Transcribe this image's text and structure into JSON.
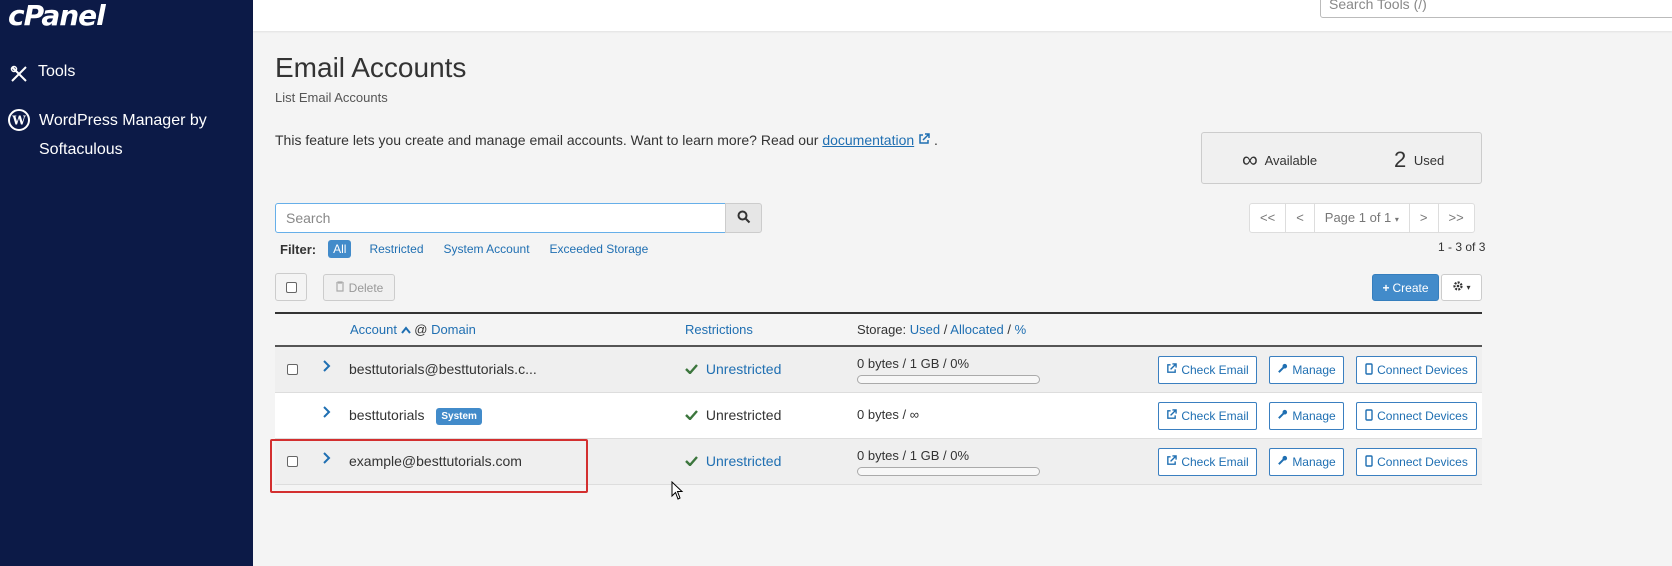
{
  "sidebar": {
    "logo": "cPanel",
    "items": [
      {
        "label": "Tools",
        "icon": "tools-icon"
      },
      {
        "label": "WordPress Manager by Softaculous",
        "icon": "wordpress-icon"
      }
    ]
  },
  "topbar": {
    "search_placeholder": "Search Tools (/)"
  },
  "page": {
    "title": "Email Accounts",
    "subtitle": "List Email Accounts",
    "description": "This feature lets you create and manage email accounts. Want to learn more? Read our",
    "doc_link": "documentation",
    "desc_end": "."
  },
  "stats": {
    "available_value": "∞",
    "available_label": "Available",
    "used_value": "2",
    "used_label": "Used"
  },
  "search": {
    "placeholder": "Search"
  },
  "filter": {
    "label": "Filter:",
    "options": [
      "All",
      "Restricted",
      "System Account",
      "Exceeded Storage"
    ],
    "active": "All"
  },
  "pagination": {
    "first": "<<",
    "prev": "<",
    "page_label": "Page 1 of 1",
    "next": ">",
    "last": ">>",
    "count": "1 - 3 of 3"
  },
  "toolbar": {
    "delete_label": "Delete",
    "create_label": "Create"
  },
  "table": {
    "headers": {
      "account": "Account",
      "at": "@",
      "domain": "Domain",
      "restrictions": "Restrictions",
      "storage_prefix": "Storage:",
      "storage_used": "Used",
      "sep1": "/",
      "storage_allocated": "Allocated",
      "sep2": "/",
      "storage_percent": "%"
    },
    "rows": [
      {
        "account": "besttutorials@besttutorials.c...",
        "badge": "",
        "restriction": "Unrestricted",
        "storage": "0 bytes / 1 GB / 0%",
        "usage": 0,
        "check_email": "Check Email",
        "manage": "Manage",
        "connect": "Connect Devices"
      },
      {
        "account": "besttutorials",
        "badge": "System",
        "restriction": "Unrestricted",
        "storage": "0 bytes / ∞",
        "check_email": "Check Email",
        "manage": "Manage",
        "connect": "Connect Devices"
      },
      {
        "account": "example@besttutorials.com",
        "badge": "",
        "restriction": "Unrestricted",
        "storage": "0 bytes / 1 GB / 0%",
        "usage": 0,
        "check_email": "Check Email",
        "manage": "Manage",
        "connect": "Connect Devices"
      }
    ]
  },
  "colors": {
    "sidebar_bg": "#0c1a47",
    "link": "#1f6fb2",
    "primary": "#428bca",
    "success": "#3c763d",
    "highlight": "#d32f2f"
  }
}
